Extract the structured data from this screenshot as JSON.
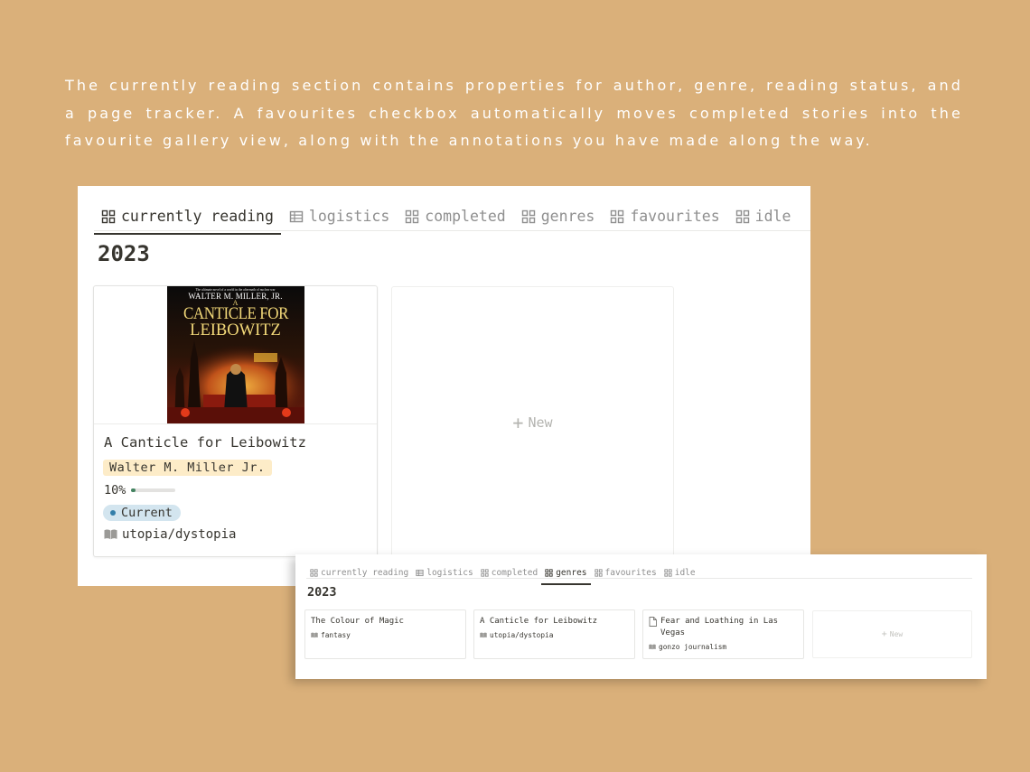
{
  "intro_text": "The currently reading section contains properties for author, genre, reading status, and a page tracker. A favourites checkbox automatically moves completed stories into the favourite gallery view, along with the annotations you have made along the way.",
  "main": {
    "tabs": [
      {
        "label": "currently reading",
        "icon": "gallery-icon",
        "active": true
      },
      {
        "label": "logistics",
        "icon": "table-icon",
        "active": false
      },
      {
        "label": "completed",
        "icon": "gallery-icon",
        "active": false
      },
      {
        "label": "genres",
        "icon": "gallery-icon",
        "active": false
      },
      {
        "label": "favourites",
        "icon": "gallery-icon",
        "active": false
      },
      {
        "label": "idle",
        "icon": "gallery-icon",
        "active": false
      }
    ],
    "group_title": "2023",
    "card": {
      "cover_lines": {
        "tagline": "The ultimate novel of a world in the aftermath of nuclear war",
        "author": "WALTER M. MILLER, JR.",
        "title_1": "A",
        "title_2": "CANTICLE FOR",
        "title_3": "LEIBOWITZ"
      },
      "title": "A Canticle for Leibowitz",
      "author": "Walter M. Miller Jr.",
      "progress_label": "10%",
      "progress": 0.1,
      "status": "Current",
      "genre": "utopia/dystopia"
    },
    "new_label": "New"
  },
  "inset": {
    "tabs": [
      {
        "label": "currently reading",
        "icon": "gallery-icon",
        "active": false
      },
      {
        "label": "logistics",
        "icon": "table-icon",
        "active": false
      },
      {
        "label": "completed",
        "icon": "gallery-icon",
        "active": false
      },
      {
        "label": "genres",
        "icon": "gallery-icon",
        "active": true
      },
      {
        "label": "favourites",
        "icon": "gallery-icon",
        "active": false
      },
      {
        "label": "idle",
        "icon": "gallery-icon",
        "active": false
      }
    ],
    "group_title": "2023",
    "cards": [
      {
        "title": "The Colour of Magic",
        "genre": "fantasy",
        "title_icon": ""
      },
      {
        "title": "A Canticle for Leibowitz",
        "genre": "utopia/dystopia",
        "title_icon": ""
      },
      {
        "title_line1": "Fear and Loathing in Las",
        "title_line2": "Vegas",
        "genre": "gonzo journalism",
        "title_icon": "page-icon"
      }
    ],
    "new_label": "New"
  },
  "colors": {
    "background": "#dab07a",
    "author_tag": "#fdecc8",
    "status_pill": "#d3e5ef",
    "status_dot": "#337ea9",
    "progress_fill": "#448361"
  }
}
